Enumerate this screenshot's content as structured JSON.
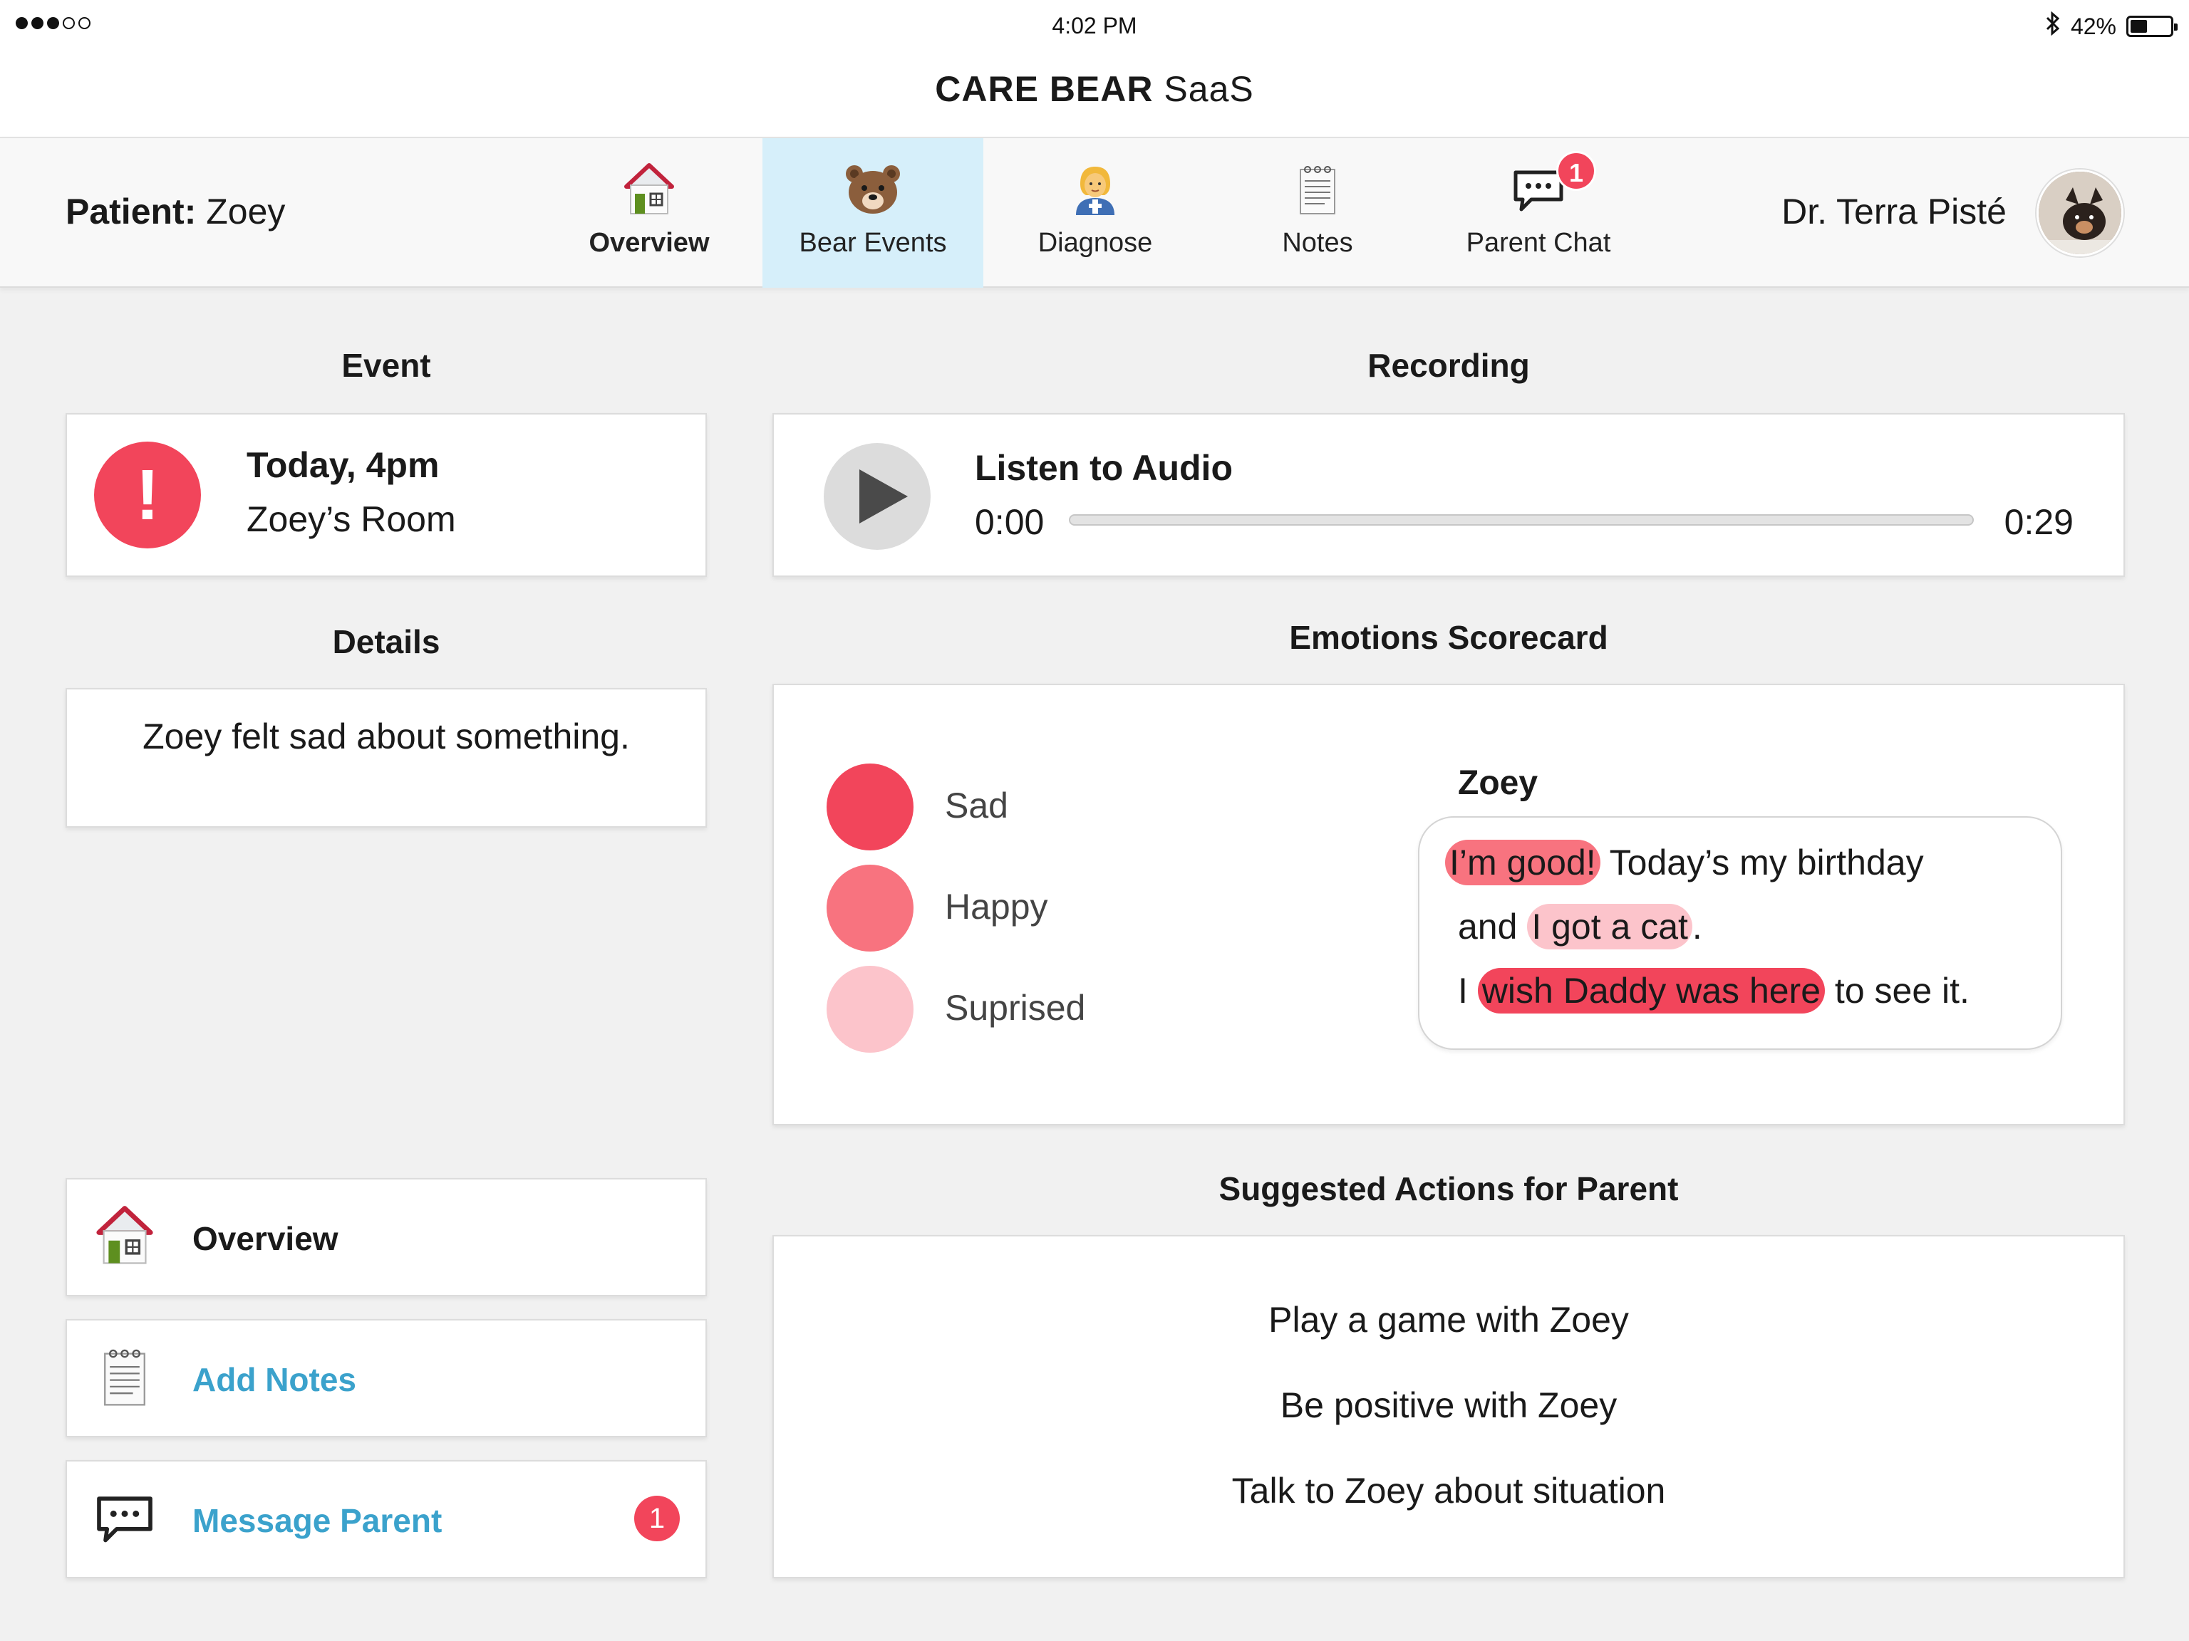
{
  "status_bar": {
    "time": "4:02 PM",
    "battery": "42%",
    "battery_level": 0.42
  },
  "app": {
    "title_bold": "CARE BEAR",
    "title_rest": "SaaS"
  },
  "header": {
    "patient_label": "Patient:",
    "patient_name": "Zoey",
    "doctor": "Dr. Terra Pisté"
  },
  "tabs": [
    {
      "label": "Overview",
      "icon": "house-icon",
      "active": false
    },
    {
      "label": "Bear Events",
      "icon": "bear-face-icon",
      "active": true
    },
    {
      "label": "Diagnose",
      "icon": "health-worker-icon",
      "active": false
    },
    {
      "label": "Notes",
      "icon": "notepad-icon",
      "active": false
    },
    {
      "label": "Parent Chat",
      "icon": "chat-bubble-icon",
      "active": false,
      "badge": "1"
    }
  ],
  "event": {
    "heading": "Event",
    "time": "Today, 4pm",
    "place": "Zoey’s Room",
    "alert_symbol": "!"
  },
  "recording": {
    "heading": "Recording",
    "title": "Listen to Audio",
    "current": "0:00",
    "duration": "0:29",
    "progress": 0
  },
  "details": {
    "heading": "Details",
    "text": "Zoey felt sad about something."
  },
  "emotions": {
    "heading": "Emotions Scorecard",
    "items": [
      {
        "label": "Sad",
        "color": "#f2455b"
      },
      {
        "label": "Happy",
        "color": "#f8737f"
      },
      {
        "label": "Suprised",
        "color": "#fcc4cb"
      }
    ],
    "speaker": "Zoey",
    "quote": {
      "l1_hl": "I’m good!",
      "l1_rest": " Today’s my birthday",
      "l2_pre": "and ",
      "l2_hl": "I got a cat",
      "l2_post": ".",
      "l3_pre": "I ",
      "l3_hl": "wish Daddy was here",
      "l3_post": " to see it."
    }
  },
  "actions": {
    "overview": "Overview",
    "add_notes": "Add Notes",
    "message_parent": "Message Parent",
    "message_badge": "1"
  },
  "suggestions": {
    "heading": "Suggested Actions for Parent",
    "items": [
      "Play a game with Zoey",
      "Be positive with Zoey",
      "Talk to Zoey about situation"
    ]
  },
  "colors": {
    "accent_red": "#f2455b",
    "active_tab": "#d6effa",
    "link_blue": "#3ba2cc"
  }
}
